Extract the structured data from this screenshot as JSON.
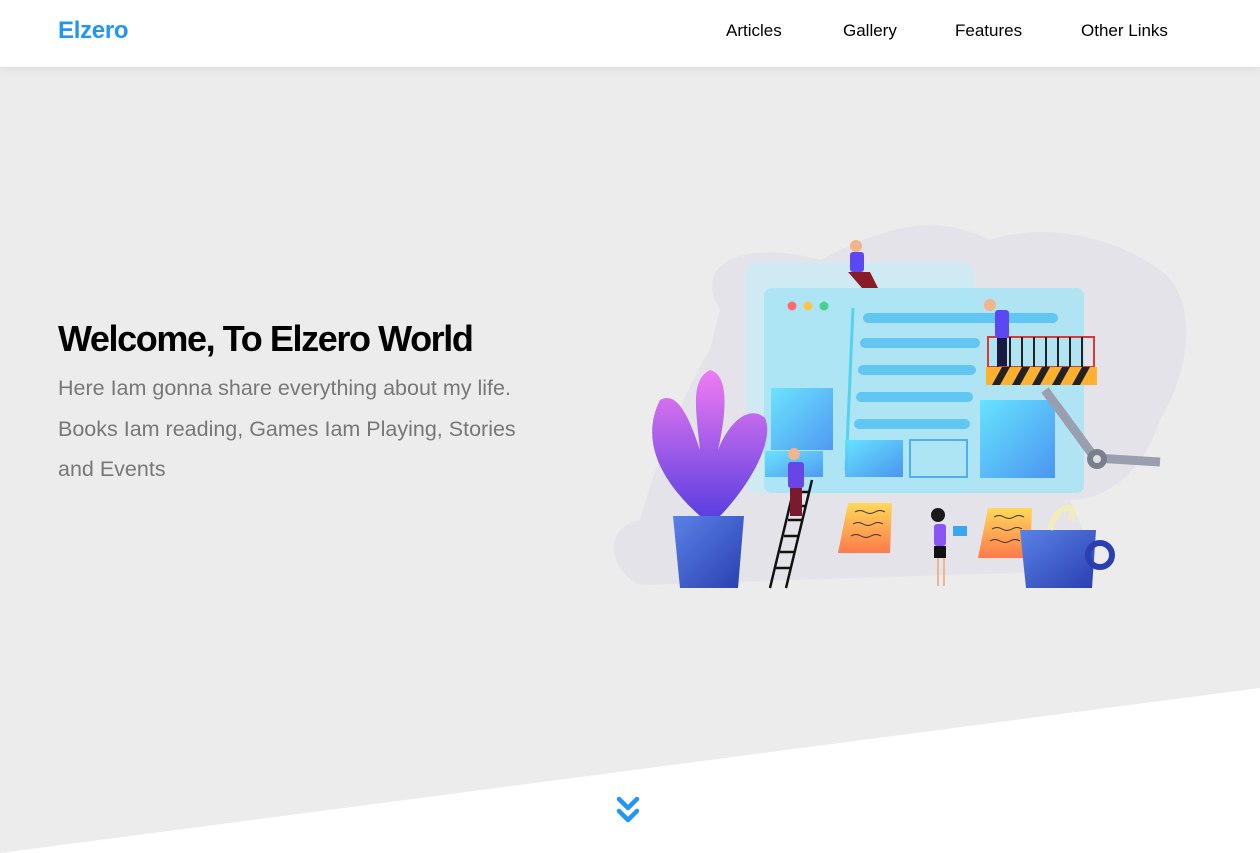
{
  "header": {
    "logo": "Elzero",
    "nav": [
      {
        "label": "Articles"
      },
      {
        "label": "Gallery"
      },
      {
        "label": "Features"
      },
      {
        "label": "Other Links"
      }
    ]
  },
  "landing": {
    "title": "Welcome, To Elzero World",
    "description": "Here Iam gonna share everything about my life. Books Iam reading, Games Iam Playing, Stories and Events"
  },
  "colors": {
    "brand": "#2196f3",
    "landing_background": "#ececec",
    "text_muted": "#777777"
  },
  "icons": {
    "go_down": "double-chevron-down-icon"
  }
}
